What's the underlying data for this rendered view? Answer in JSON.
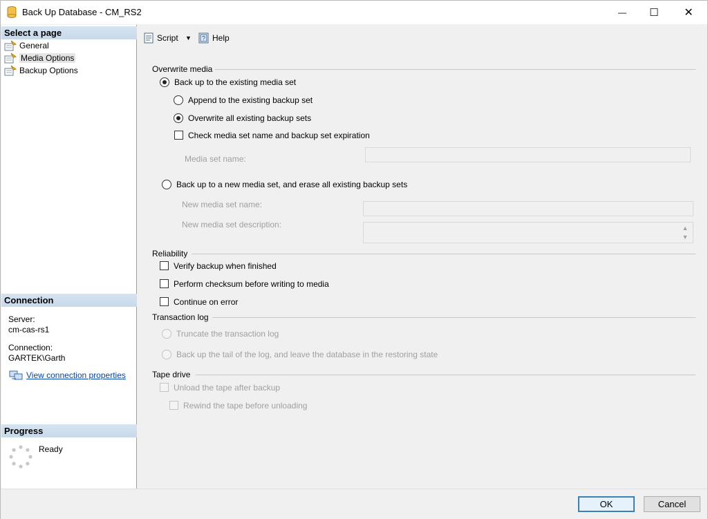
{
  "window": {
    "title": "Back Up Database - CM_RS2",
    "minimize": "—",
    "maximize": "☐",
    "close": "✕"
  },
  "left": {
    "select_page_header": "Select a page",
    "pages": [
      {
        "label": "General"
      },
      {
        "label": "Media Options"
      },
      {
        "label": "Backup Options"
      }
    ],
    "connection_header": "Connection",
    "server_label": "Server:",
    "server_value": "cm-cas-rs1",
    "connection_label": "Connection:",
    "connection_value": "GARTEK\\Garth",
    "view_connection_link": "View connection properties",
    "progress_header": "Progress",
    "progress_status": "Ready"
  },
  "toolbar": {
    "script_label": "Script",
    "script_dropdown": "▼",
    "help_label": "Help"
  },
  "overwrite_media": {
    "title": "Overwrite media",
    "existing_set": "Back up to the existing media set",
    "append": "Append to the existing backup set",
    "overwrite_all": "Overwrite all existing backup sets",
    "check_media": "Check media set name and backup set expiration",
    "media_set_name_label": "Media set name:",
    "media_set_name_value": "",
    "new_set": "Back up to a new media set, and erase all existing backup sets",
    "new_media_set_name_label": "New media set name:",
    "new_media_set_name_value": "",
    "new_media_set_desc_label": "New media set description:",
    "new_media_set_desc_value": ""
  },
  "reliability": {
    "title": "Reliability",
    "verify": "Verify backup when finished",
    "checksum": "Perform checksum before writing to media",
    "continue_on_error": "Continue on error"
  },
  "transaction_log": {
    "title": "Transaction log",
    "truncate": "Truncate the transaction log",
    "tail": "Back up the tail of the log, and leave the database in the restoring state"
  },
  "tape_drive": {
    "title": "Tape drive",
    "unload": "Unload the tape after backup",
    "rewind": "Rewind the tape before unloading"
  },
  "buttons": {
    "ok": "OK",
    "cancel": "Cancel"
  }
}
